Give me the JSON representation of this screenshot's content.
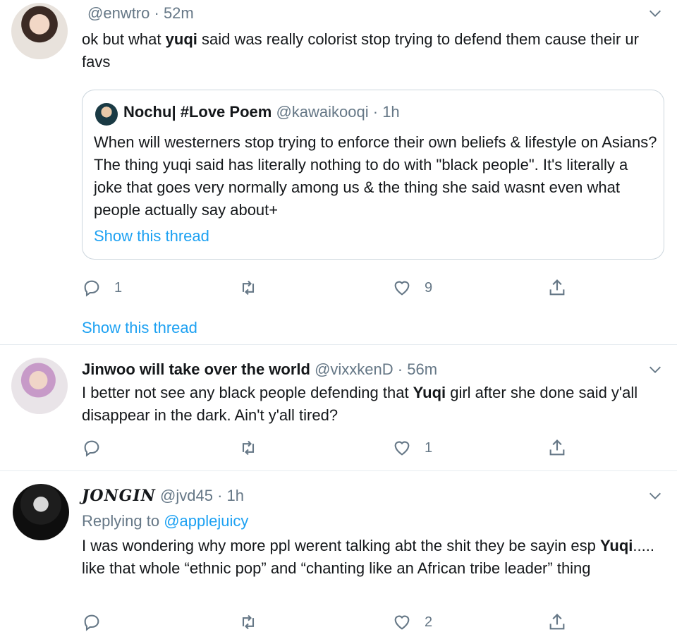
{
  "tweets": [
    {
      "handle": "@enwtro",
      "time": "· 52m",
      "text_before": "ok but what ",
      "text_bold": "yuqi",
      "text_after": " said was really colorist stop trying to defend them cause their ur favs",
      "quote": {
        "name": "Nochu| #Love Poem",
        "handle": "@kawaikooqi",
        "time": "· 1h",
        "text": "When will westerners stop trying to enforce their own beliefs & lifestyle on Asians? The thing yuqi said has literally nothing to do with \"black people\". It's literally a joke that goes very normally among us & the thing she said wasnt even what people actually say about+",
        "show_thread": "Show this thread"
      },
      "replies": "1",
      "retweets": "",
      "likes": "9",
      "show_thread": "Show this thread"
    },
    {
      "name": "Jinwoo will take over the world",
      "handle": "@vixxkenD",
      "time": "· 56m",
      "text_before": "I better not see any black people defending that ",
      "text_bold": "Yuqi",
      "text_after": " girl after she done said y'all disappear in the dark. Ain't y'all tired?",
      "replies": "",
      "retweets": "",
      "likes": "1"
    },
    {
      "name": "JONGIN",
      "handle": "@jvd45",
      "time": "· 1h",
      "replying_label": "Replying to ",
      "replying_handle": "@applejuicy",
      "text_before": "I was wondering why more ppl werent talking abt the shit they be sayin esp ",
      "text_bold": "Yuqi",
      "text_after": "..... like that whole “ethnic pop” and “chanting like an African tribe leader” thing",
      "replies": "",
      "retweets": "",
      "likes": "2"
    }
  ],
  "colors": {
    "text": "#14171a",
    "secondary": "#657786",
    "accent": "#1da1f2",
    "border": "#ccd6dd",
    "divider": "#e6ecf0"
  },
  "icons": [
    "chevron-down-icon",
    "reply-icon",
    "retweet-icon",
    "like-icon",
    "share-icon"
  ]
}
